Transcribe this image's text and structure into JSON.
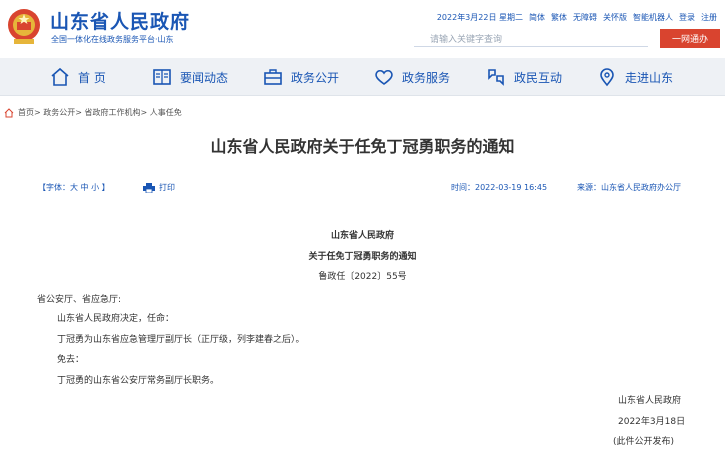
{
  "header": {
    "site_name": "山东省人民政府",
    "site_sub": "全国一体化在线政务服务平台·山东",
    "top_links": [
      "2022年3月22日 星期二",
      "简体",
      "繁体",
      "无障碍",
      "关怀版",
      "智能机器人",
      "登录",
      "注册"
    ],
    "search_placeholder": "请输入关键字查询",
    "search_button": "一网通办"
  },
  "nav": {
    "items": [
      {
        "label": "首 页",
        "icon": "home-icon"
      },
      {
        "label": "要闻动态",
        "icon": "newspaper-icon"
      },
      {
        "label": "政务公开",
        "icon": "briefcase-icon"
      },
      {
        "label": "政务服务",
        "icon": "heart-icon"
      },
      {
        "label": "政民互动",
        "icon": "interaction-icon"
      },
      {
        "label": "走进山东",
        "icon": "location-icon"
      }
    ]
  },
  "breadcrumb": "首页> 政务公开> 省政府工作机构> 人事任免",
  "article": {
    "title": "山东省人民政府关于任免丁冠勇职务的通知",
    "font_size_label": "【字体：大 中 小 】",
    "print_label": "打印",
    "time": "时间：2022-03-19 16:45",
    "source": "来源：山东省人民政府办公厅"
  },
  "doc": {
    "issuer": "山东省人民政府",
    "heading": "关于任免丁冠勇职务的通知",
    "doc_no": "鲁政任〔2022〕55号",
    "addressee": "省公安厅、省应急厅:",
    "p1": "山东省人民政府决定，任命：",
    "p2": "丁冠勇为山东省应急管理厅副厅长（正厅级，列李建春之后）。",
    "p3": "免去：",
    "p4": "丁冠勇的山东省公安厅常务副厅长职务。",
    "sign": "山东省人民政府",
    "date": "2022年3月18日",
    "note": "(此件公开发布)"
  },
  "colors": {
    "brand_blue": "#1a56b4",
    "search_red": "#d9442f",
    "nav_bg": "#eef1f5"
  }
}
